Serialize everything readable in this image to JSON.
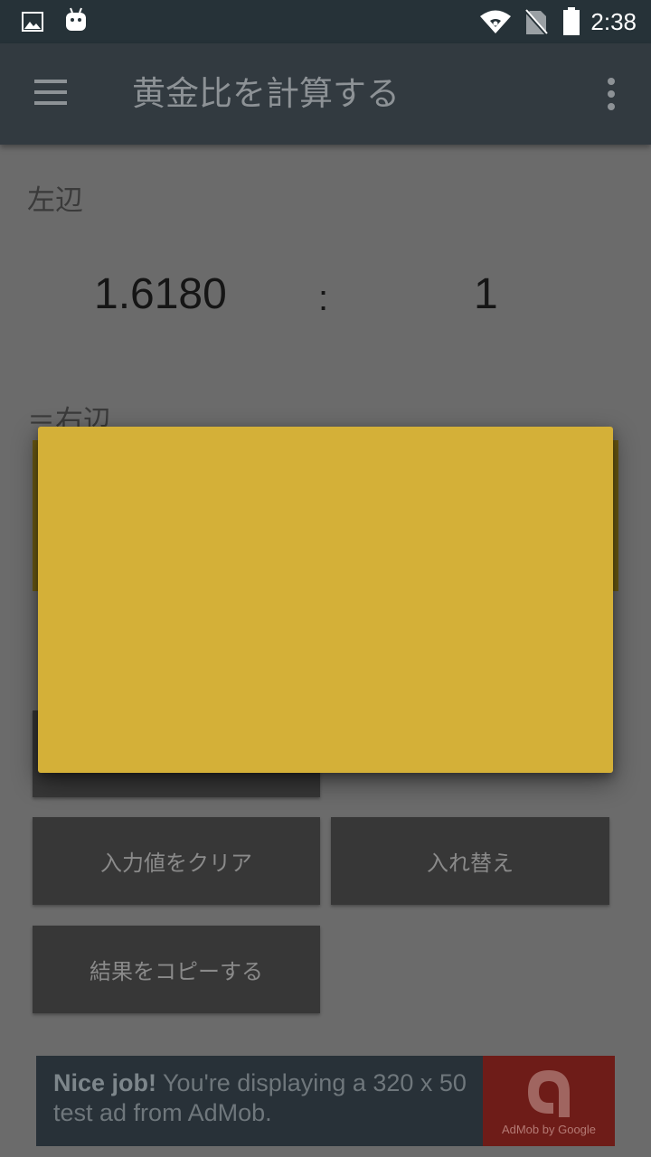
{
  "status_bar": {
    "time": "2:38",
    "icons": [
      "image-icon",
      "android-icon",
      "wifi-icon",
      "no-sim-icon",
      "battery-icon"
    ]
  },
  "app_bar": {
    "title": "黄金比を計算する",
    "icons": [
      "menu-icon",
      "more-vert-icon"
    ]
  },
  "content": {
    "left_label": "左辺",
    "ratio_left": "1.6180",
    "ratio_separator": ":",
    "ratio_right": "1",
    "right_label": "＝右辺"
  },
  "buttons": {
    "clear": "入力値をクリア",
    "swap": "入れ替え",
    "copy": "結果をコピーする"
  },
  "ad": {
    "bold": "Nice job!",
    "text": " You're displaying a 320 x 50 test ad from AdMob.",
    "logo_text": "AdMob by Google"
  },
  "colors": {
    "status_bar": "#263238",
    "app_bar": "#323a40",
    "dialog": "#d4b038",
    "scrim_bg": "#6b6b6b",
    "button": "#373737",
    "ad_logo": "#6e1c18"
  }
}
